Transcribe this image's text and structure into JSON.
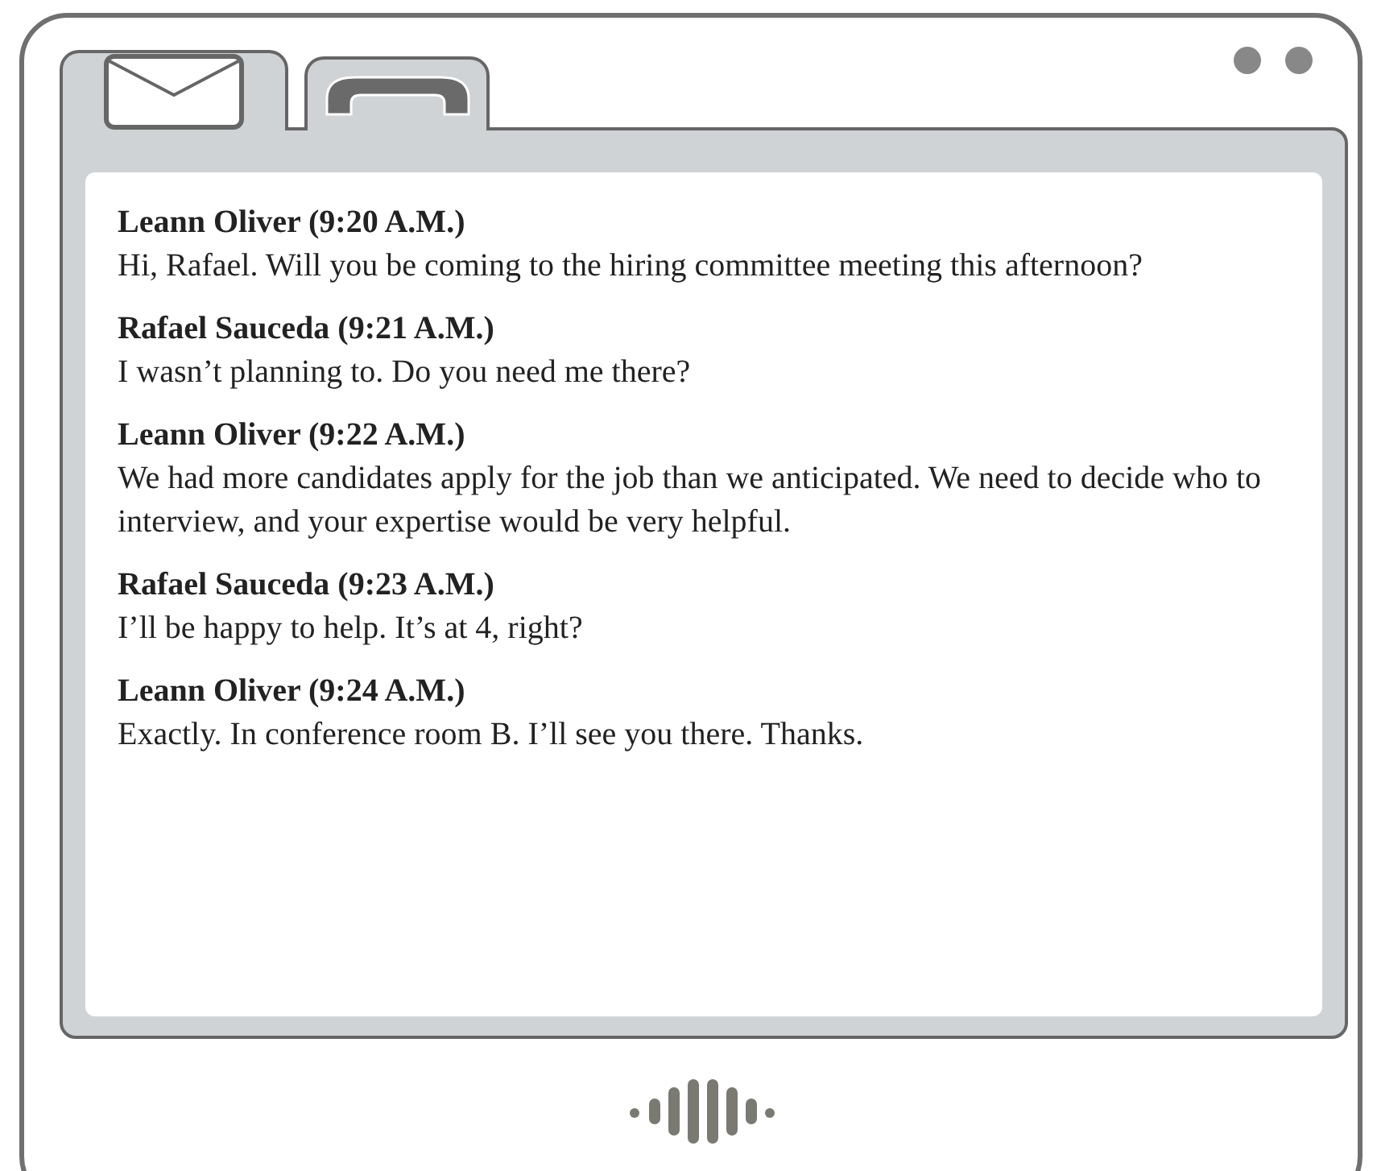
{
  "tabs": [
    {
      "kind": "mail"
    },
    {
      "kind": "phone"
    }
  ],
  "messages": [
    {
      "sender": "Leann Oliver (9:20 A.M.)",
      "text": "Hi, Rafael. Will you be coming to the hiring committee meeting this afternoon?"
    },
    {
      "sender": "Rafael Sauceda (9:21 A.M.)",
      "text": "I wasn’t planning to. Do you need me there?"
    },
    {
      "sender": "Leann Oliver (9:22 A.M.)",
      "text": "We had more candidates apply for the job than we anticipated. We need to decide who to interview, and your expertise would be very helpful."
    },
    {
      "sender": "Rafael Sauceda (9:23 A.M.)",
      "text": "I’ll be happy to help. It’s at 4, right?"
    },
    {
      "sender": "Leann Oliver (9:24 A.M.)",
      "text": "Exactly. In conference room B. I’ll see you there. Thanks."
    }
  ]
}
